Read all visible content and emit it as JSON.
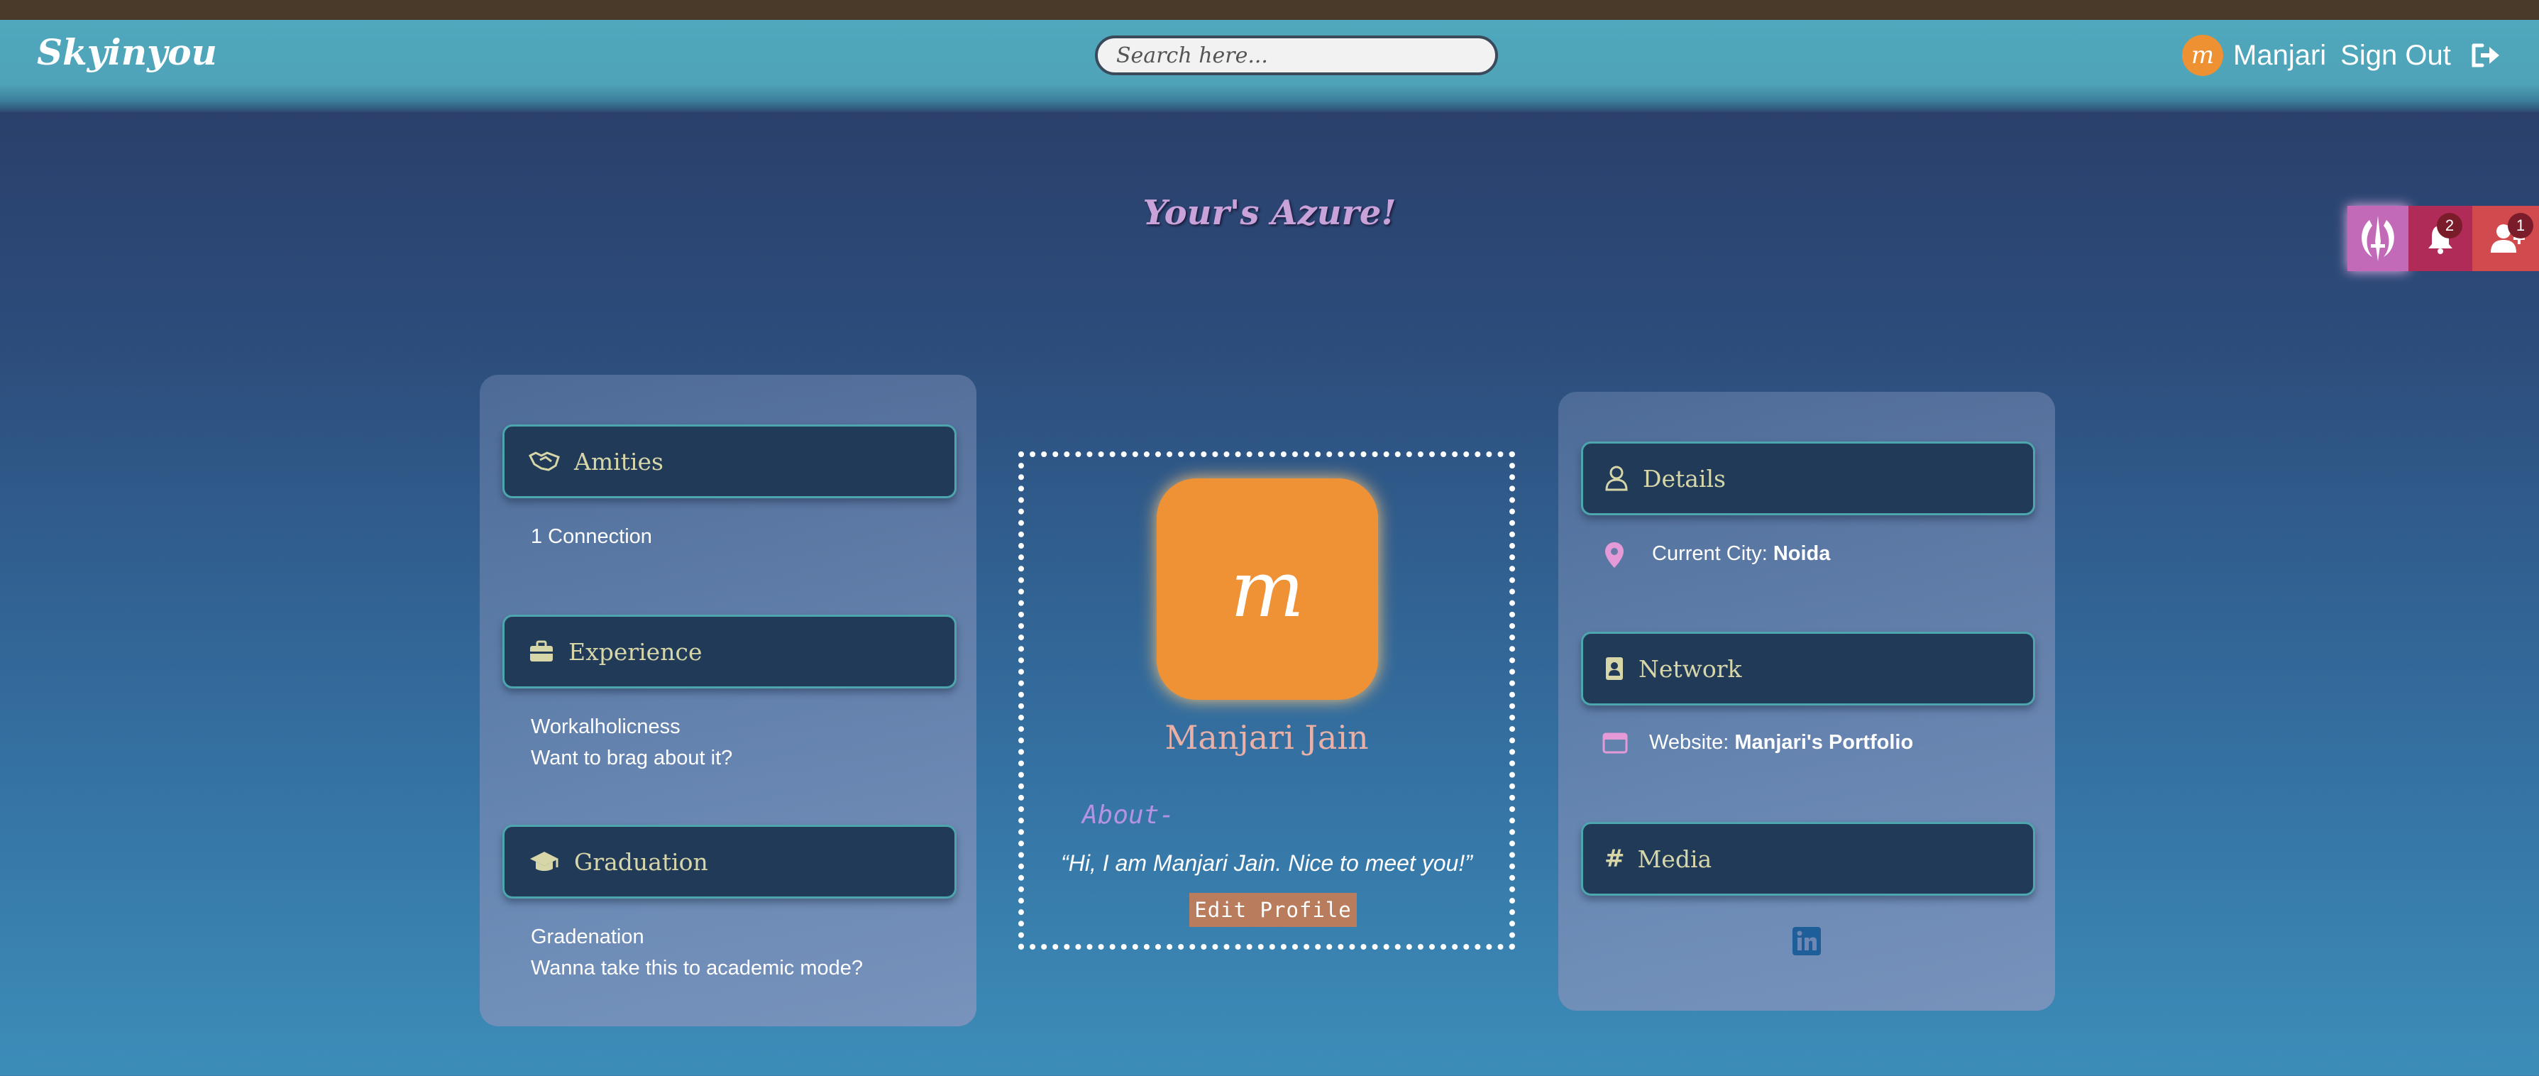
{
  "navbar": {
    "brand": "Skyinyou",
    "search_placeholder": "Search here...",
    "user_initial": "m",
    "user_name": "Manjari",
    "signout_label": "Sign Out"
  },
  "hero": {
    "title": "Your's  Azure!"
  },
  "floating_tabs": {
    "notifications_count": "2",
    "friend_requests_count": "1"
  },
  "left_panel": {
    "amities": {
      "title": "Amities",
      "text": "1 Connection"
    },
    "experience": {
      "title": "Experience",
      "line1": "Workalholicness",
      "line2": "Want to brag about it?"
    },
    "graduation": {
      "title": "Graduation",
      "line1": "Gradenation",
      "line2": "Wanna take this to academic mode?"
    }
  },
  "profile": {
    "initial": "m",
    "name": "Manjari Jain",
    "about_label": "About-",
    "quote": "“Hi, I am Manjari Jain. Nice to meet you!”",
    "edit_button": "Edit Profile"
  },
  "right_panel": {
    "details": {
      "title": "Details",
      "city_label": "Current City: ",
      "city_value": "Noida"
    },
    "network": {
      "title": "Network",
      "website_label": "Website: ",
      "website_value": "Manjari's Portfolio"
    },
    "media": {
      "title": "Media",
      "icon": "linkedin-icon"
    }
  },
  "colors": {
    "navbar": "#4fa8bd",
    "accent_orange": "#ee9235",
    "section_head": "#213a58",
    "section_head_text": "#d6d6a8",
    "hero_title": "#c8a2d8"
  }
}
